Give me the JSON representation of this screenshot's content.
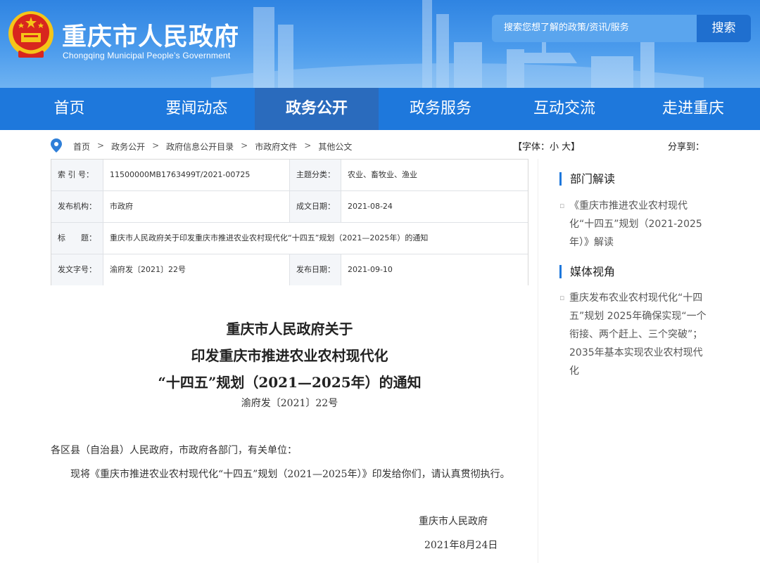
{
  "header": {
    "title": "重庆市人民政府",
    "subtitle": "Chongqing Municipal People’s Government",
    "search_placeholder": "搜索您想了解的政策/资讯/服务",
    "search_button": "搜索"
  },
  "nav": {
    "items": [
      "首页",
      "要闻动态",
      "政务公开",
      "政务服务",
      "互动交流",
      "走进重庆"
    ],
    "active": "政务公开"
  },
  "breadcrumb": {
    "items": [
      "首页",
      "政务公开",
      "政府信息公开目录",
      "市政府文件",
      "其他公文"
    ],
    "separator": ">"
  },
  "tools": {
    "font_size": "【字体：小 大】",
    "share": "分享到："
  },
  "meta": {
    "index_label": "索 引 号：",
    "index_value": "11500000MB1763499T/2021-00725",
    "category_label": "主题分类：",
    "category_value": "农业、畜牧业、渔业",
    "issuer_label": "发布机构：",
    "issuer_value": "市政府",
    "written_label": "成文日期：",
    "written_value": "2021-08-24",
    "title_label": "标　　题：",
    "title_value": "重庆市人民政府关于印发重庆市推进农业农村现代化“十四五”规划（2021—2025年）的通知",
    "docno_label": "发文字号：",
    "docno_value": "渝府发〔2021〕22号",
    "published_label": "发布日期：",
    "published_value": "2021-09-10"
  },
  "article": {
    "title_lines": [
      "重庆市人民政府关于",
      "印发重庆市推进农业农村现代化",
      "“十四五”规划（2021—2025年）的通知"
    ],
    "doc_number": "渝府发〔2021〕22号",
    "salutation": "各区县（自治县）人民政府，市政府各部门，有关单位：",
    "paragraph": "现将《重庆市推进农业农村现代化“十四五”规划（2021—2025年）》印发给你们，请认真贯彻执行。",
    "signature": "重庆市人民政府",
    "date": "2021年8月24日"
  },
  "sidebar": {
    "section1_title": "部门解读",
    "section1_links": [
      "《重庆市推进农业农村现代化“十四五”规划（2021-2025年）》解读"
    ],
    "section2_title": "媒体视角",
    "section2_links": [
      "重庆发布农业农村现代化“十四五”规划 2025年确保实现“一个衔接、两个赶上、三个突破”；2035年基本实现农业农村现代化"
    ]
  },
  "colors": {
    "header_blue": "#2f84e2",
    "nav_blue": "#1e78dc",
    "nav_active": "#2a6bbd",
    "emblem_red": "#d8261e",
    "emblem_gold": "#f5c518"
  }
}
